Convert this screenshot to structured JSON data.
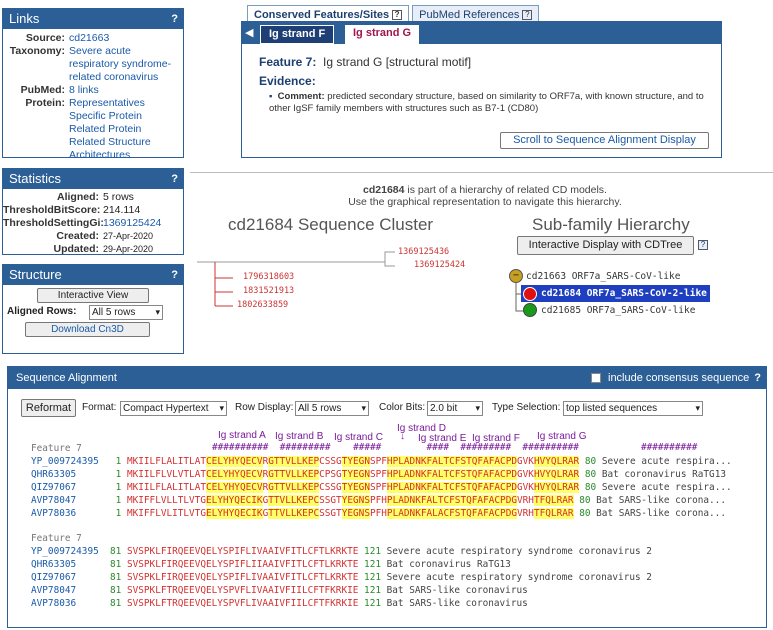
{
  "links": {
    "title": "Links",
    "help": "?",
    "source_key": "Source:",
    "source": "cd21663",
    "taxonomy_key": "Taxonomy:",
    "taxonomy": [
      "Severe acute",
      "respiratory syndrome-",
      "related coronavirus"
    ],
    "pubmed_key": "PubMed:",
    "pubmed": "8 links",
    "protein_key": "Protein:",
    "protein": [
      "Representatives",
      "Specific Protein",
      "Related Protein",
      "Related Structure",
      "Architectures"
    ]
  },
  "statistics": {
    "title": "Statistics",
    "help": "?",
    "rows": [
      {
        "k": "Aligned:",
        "v": "5 rows",
        "style": "plain"
      },
      {
        "k": "ThresholdBitScore:",
        "v": "214.114",
        "style": "plain"
      },
      {
        "k": "ThresholdSettingGi:",
        "v": "1369125424",
        "style": "link"
      },
      {
        "k": "Created:",
        "v": "27-Apr-2020",
        "style": "small"
      },
      {
        "k": "Updated:",
        "v": "29-Apr-2020",
        "style": "small"
      }
    ]
  },
  "structure": {
    "title": "Structure",
    "help": "?",
    "interactive_view": "Interactive View",
    "aligned_rows_label": "Aligned Rows:",
    "aligned_rows_value": "All 5 rows",
    "download": "Download Cn3D"
  },
  "feature_tabs": {
    "conserved": "Conserved Features/Sites",
    "pubmed": "PubMed References",
    "q": "?"
  },
  "feature": {
    "nav_prev": "◀",
    "strand_f": "Ig strand F",
    "strand_g": "Ig strand G",
    "title_key": "Feature 7:",
    "title_val": "Ig strand G [structural motif]",
    "evidence": "Evidence:",
    "comment_key": "Comment:",
    "comment": "predicted secondary structure, based on similarity to ORF7a, with known structure, and to other IgSF family members with structures such as B7-1 (CD80)",
    "scroll_btn": "Scroll to Sequence Alignment Display"
  },
  "hierarchy": {
    "cd_id": "cd21684",
    "intro_rest": " is part of a hierarchy of related CD models.",
    "intro2": "Use the graphical representation to navigate this hierarchy.",
    "cluster_title": "cd21684 Sequence Cluster",
    "subfamily_title": "Sub-family Hierarchy",
    "cdtree_btn": "Interactive Display with CDTree",
    "tree_labels": [
      "1369125436",
      "1369125424",
      "1796318603",
      "1831521913",
      "1802633859"
    ],
    "nodes": [
      {
        "id": "cd21663",
        "name": "ORF7a_SARS-CoV-like"
      },
      {
        "id": "cd21684",
        "name": "ORF7a_SARS-CoV-2-like"
      },
      {
        "id": "cd21685",
        "name": "ORF7a_SARS-CoV-like"
      }
    ]
  },
  "alignment": {
    "title": "Sequence Alignment",
    "consensus": "include consensus sequence",
    "help": "?",
    "reformat": "Reformat",
    "format_label": "Format:",
    "format_value": "Compact Hypertext",
    "rowdisplay_label": "Row Display:",
    "rowdisplay_value": "All 5 rows",
    "colorbits_label": "Color Bits:",
    "colorbits_value": "2.0 bit",
    "typesel_label": "Type Selection:",
    "typesel_value": "top listed sequences",
    "strands": [
      "Ig strand A",
      "Ig strand B",
      "Ig strand C",
      "Ig strand D",
      "Ig strand E",
      "Ig strand F",
      "Ig strand G"
    ],
    "feature_label": "Feature 7",
    "block1": [
      {
        "acc": "YP_009724395",
        "start": "1",
        "seq": "MKIILFLALITLATCELYHYQECVRGTTVLLKEPCSSGTYEGNSPFHPLADNKFALTCFSTQFAFACPDGVKHVYQLRAR",
        "end": "80",
        "desc": "Severe acute respira..."
      },
      {
        "acc": "QHR63305",
        "start": "1",
        "seq": "MKIILFLVLVTLATCELYHYQECVRGTTVLLKEPCPSGTYEGNSPFHPLADNKFALTCFSTQFAFACPDGVKHVYQLRAR",
        "end": "80",
        "desc": "Bat coronavirus RaTG13"
      },
      {
        "acc": "QIZ97067",
        "start": "1",
        "seq": "MKIILFLALITLATCELYHYQECVRGTTVLLKEPCSSGTYEGNSPFHPLADNKFALTCFSTQFAFACPDGVKHVYQLRAR",
        "end": "80",
        "desc": "Severe acute respira..."
      },
      {
        "acc": "AVP78047",
        "start": "1",
        "seq": "MKIFFLVLLTLVTGELYHYQECIKGTTVLLKEPCSSGTYEGNSPFHPLADNKFALTCFSTQFAFACPDGVRHTFQLRAR",
        "end": "80",
        "desc": "Bat SARS-like corona..."
      },
      {
        "acc": "AVP78036",
        "start": "1",
        "seq": "MKIFFLVLITLVTGELYHYQECIKGTTVLLKEPCSSGTYEGNSPFHPLADNKFALACFSTQFAFACPDGVRHTFQLRAR",
        "end": "80",
        "desc": "Bat SARS-like corona..."
      }
    ],
    "block2": [
      {
        "acc": "YP_009724395",
        "start": "81",
        "seq": "SVSPKLFIRQEEVQELYSPIFLIVAAIVFITLCFTLKRKTE",
        "end": "121",
        "desc": "Severe acute respiratory syndrome coronavirus 2"
      },
      {
        "acc": "QHR63305",
        "start": "81",
        "seq": "SVSPKLFIRQEEVQELYSPIFLIIAAIVFITLCFTLKRKTE",
        "end": "121",
        "desc": "Bat coronavirus RaTG13"
      },
      {
        "acc": "QIZ97067",
        "start": "81",
        "seq": "SVSPKLFIRQEEVQELYSPIFLIVAAIVFITLCFTLKRKTE",
        "end": "121",
        "desc": "Severe acute respiratory syndrome coronavirus 2"
      },
      {
        "acc": "AVP78047",
        "start": "81",
        "seq": "SVSPKLFTRQEEVQELYSPVFLIVAAIVFIILCFTFKRKIE",
        "end": "121",
        "desc": "Bat SARS-like coronavirus"
      },
      {
        "acc": "AVP78036",
        "start": "81",
        "seq": "SVSPKLFTRQEEVQELYSPVFLIVAAIVFIILCFTFKRKIE",
        "end": "121",
        "desc": "Bat SARS-like coronavirus"
      }
    ]
  }
}
